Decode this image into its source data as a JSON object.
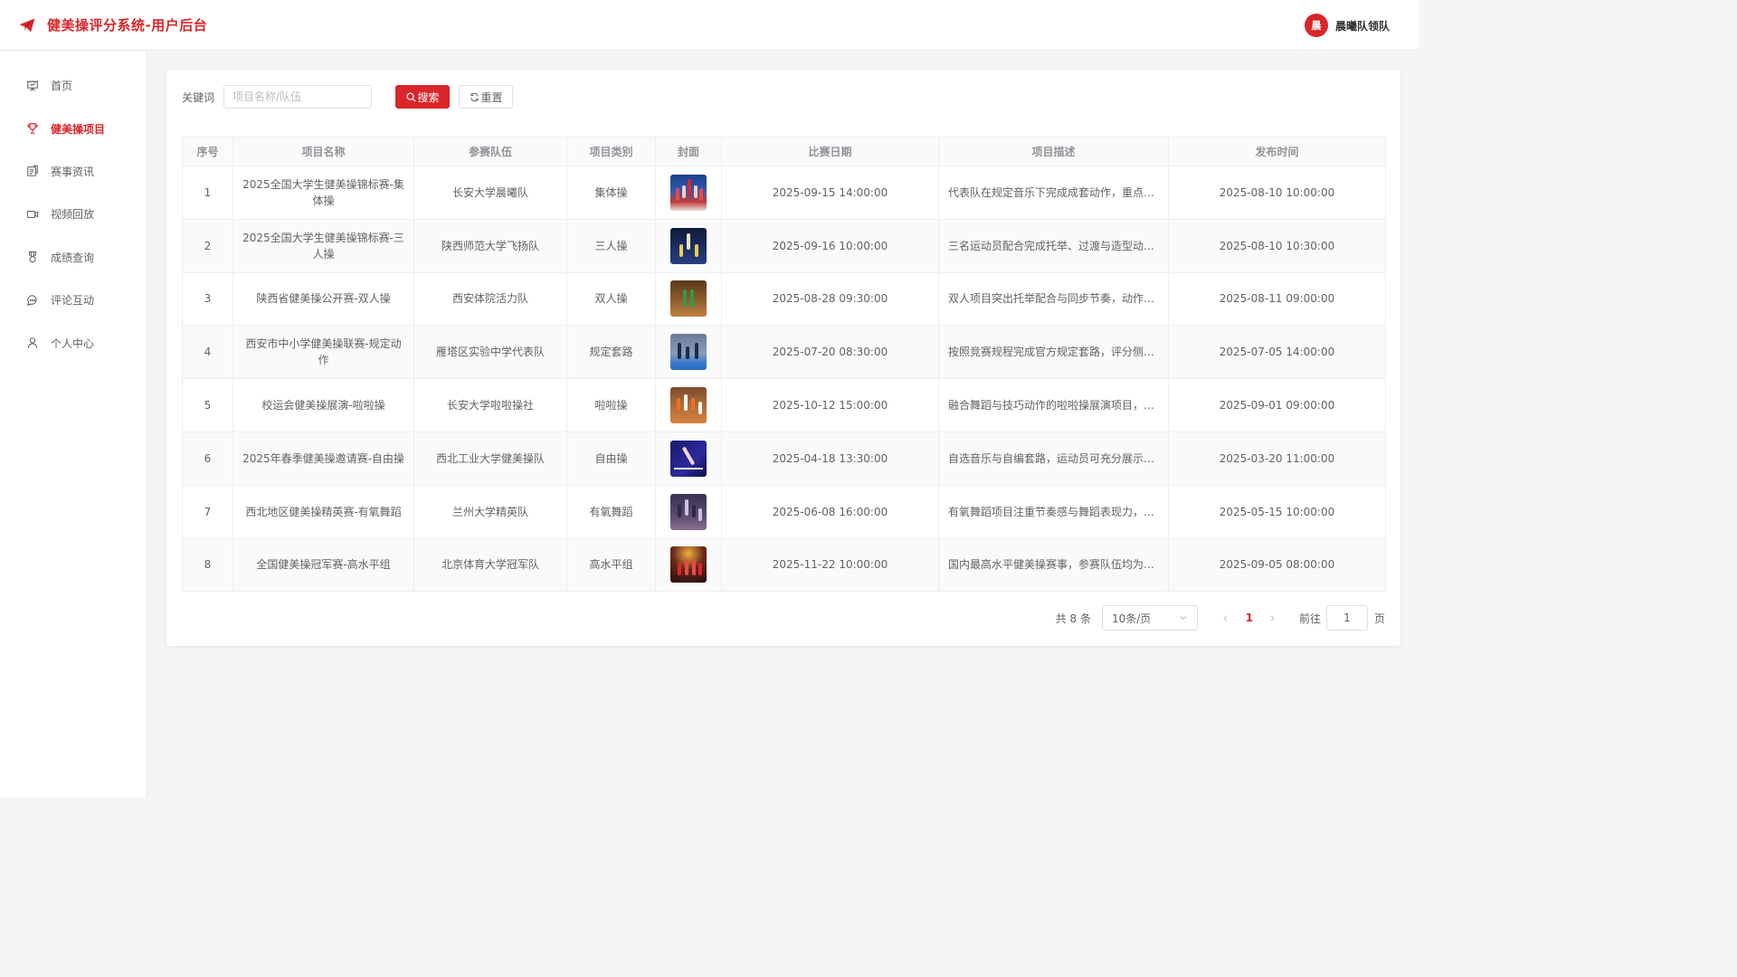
{
  "header": {
    "title": "健美操评分系统-用户后台",
    "avatar_char": "晨",
    "user_name": "晨曦队领队"
  },
  "sidebar": {
    "items": [
      {
        "label": "首页",
        "icon": "presentation-icon"
      },
      {
        "label": "健美操项目",
        "icon": "trophy-icon",
        "active": true
      },
      {
        "label": "赛事资讯",
        "icon": "news-icon"
      },
      {
        "label": "视频回放",
        "icon": "video-camera-icon"
      },
      {
        "label": "成绩查询",
        "icon": "medal-icon"
      },
      {
        "label": "评论互动",
        "icon": "chat-bubble-icon"
      },
      {
        "label": "个人中心",
        "icon": "user-icon"
      }
    ]
  },
  "search": {
    "label": "关键词",
    "placeholder": "项目名称/队伍",
    "value": "",
    "search_button": "搜索",
    "reset_button": "重置"
  },
  "table": {
    "columns": [
      "序号",
      "项目名称",
      "参赛队伍",
      "项目类别",
      "封面",
      "比赛日期",
      "项目描述",
      "发布时间"
    ],
    "rows": [
      {
        "no": "1",
        "name": "2025全国大学生健美操锦标赛-集体操",
        "team": "长安大学晨曦队",
        "category": "集体操",
        "date": "2025-09-15 14:00:00",
        "desc": "代表队在规定音乐下完成成套动作，重点考查整体配合与队形变化",
        "published": "2025-08-10 10:00:00"
      },
      {
        "no": "2",
        "name": "2025全国大学生健美操锦标赛-三人操",
        "team": "陕西师范大学飞扬队",
        "category": "三人操",
        "date": "2025-09-16 10:00:00",
        "desc": "三名运动员配合完成托举、过渡与造型动作，考查默契程度",
        "published": "2025-08-10 10:30:00"
      },
      {
        "no": "3",
        "name": "陕西省健美操公开赛-双人操",
        "team": "西安体院活力队",
        "category": "双人操",
        "date": "2025-08-28 09:30:00",
        "desc": "双人项目突出托举配合与同步节奏，动作编排要求流畅",
        "published": "2025-08-11 09:00:00"
      },
      {
        "no": "4",
        "name": "西安市中小学健美操联赛-规定动作",
        "team": "雁塔区实验中学代表队",
        "category": "规定套路",
        "date": "2025-07-20 08:30:00",
        "desc": "按照竞赛规程完成官方规定套路，评分侧重动作规范性",
        "published": "2025-07-05 14:00:00"
      },
      {
        "no": "5",
        "name": "校运会健美操展演-啦啦操",
        "team": "长安大学啦啦操社",
        "category": "啦啦操",
        "date": "2025-10-12 15:00:00",
        "desc": "融合舞蹈与技巧动作的啦啦操展演项目，强调团队氛围",
        "published": "2025-09-01 09:00:00"
      },
      {
        "no": "6",
        "name": "2025年春季健美操邀请赛-自由操",
        "team": "西北工业大学健美操队",
        "category": "自由操",
        "date": "2025-04-18 13:30:00",
        "desc": "自选音乐与自编套路，运动员可充分展示个人风格与技术",
        "published": "2025-03-20 11:00:00"
      },
      {
        "no": "7",
        "name": "西北地区健美操精英赛-有氧舞蹈",
        "team": "兰州大学精英队",
        "category": "有氧舞蹈",
        "date": "2025-06-08 16:00:00",
        "desc": "有氧舞蹈项目注重节奏感与舞蹈表现力，动作连贯性强",
        "published": "2025-05-15 10:00:00"
      },
      {
        "no": "8",
        "name": "全国健美操冠军赛-高水平组",
        "team": "北京体育大学冠军队",
        "category": "高水平组",
        "date": "2025-11-22 10:00:00",
        "desc": "国内最高水平健美操赛事，参赛队伍均为历届优胜队伍",
        "published": "2025-09-05 08:00:00"
      }
    ]
  },
  "pagination": {
    "total_text": "共 8 条",
    "page_size": "10条/页",
    "current_page": "1",
    "goto_label": "前往",
    "goto_value": "1",
    "goto_unit": "页"
  },
  "colors": {
    "accent": "#d9262a"
  }
}
